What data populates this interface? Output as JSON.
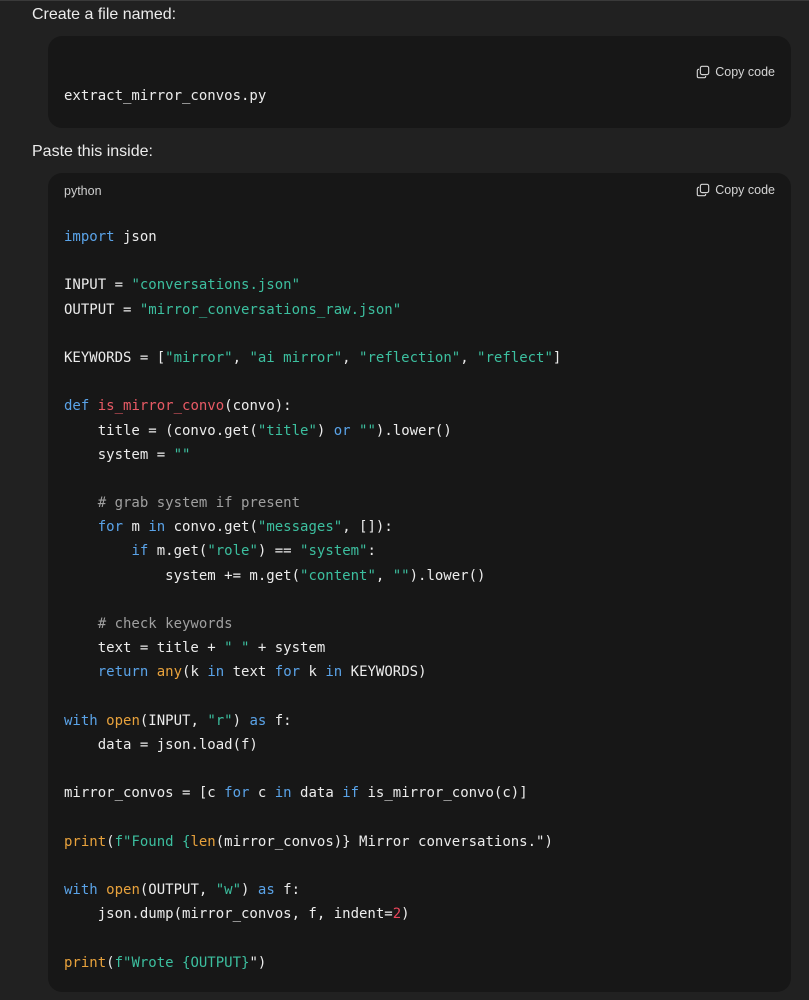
{
  "prose": {
    "create_file": "Create a file named:",
    "paste_inside": "Paste this inside:"
  },
  "filename_block": {
    "copy_label": "Copy code",
    "filename": "extract_mirror_convos.py"
  },
  "code_block": {
    "language": "python",
    "copy_label": "Copy code",
    "lines": [
      [
        {
          "t": "import",
          "c": "kw"
        },
        {
          "t": " json",
          "c": "pl"
        }
      ],
      [],
      [
        {
          "t": "INPUT = ",
          "c": "pl"
        },
        {
          "t": "\"conversations.json\"",
          "c": "str"
        }
      ],
      [
        {
          "t": "OUTPUT = ",
          "c": "pl"
        },
        {
          "t": "\"mirror_conversations_raw.json\"",
          "c": "str"
        }
      ],
      [],
      [
        {
          "t": "KEYWORDS = [",
          "c": "pl"
        },
        {
          "t": "\"mirror\"",
          "c": "str"
        },
        {
          "t": ", ",
          "c": "pl"
        },
        {
          "t": "\"ai mirror\"",
          "c": "str"
        },
        {
          "t": ", ",
          "c": "pl"
        },
        {
          "t": "\"reflection\"",
          "c": "str"
        },
        {
          "t": ", ",
          "c": "pl"
        },
        {
          "t": "\"reflect\"",
          "c": "str"
        },
        {
          "t": "]",
          "c": "pl"
        }
      ],
      [],
      [
        {
          "t": "def",
          "c": "kw"
        },
        {
          "t": " ",
          "c": "pl"
        },
        {
          "t": "is_mirror_convo",
          "c": "fn"
        },
        {
          "t": "(convo):",
          "c": "pl"
        }
      ],
      [
        {
          "t": "    title = (convo.get(",
          "c": "pl"
        },
        {
          "t": "\"title\"",
          "c": "str"
        },
        {
          "t": ") ",
          "c": "pl"
        },
        {
          "t": "or",
          "c": "kw"
        },
        {
          "t": " ",
          "c": "pl"
        },
        {
          "t": "\"\"",
          "c": "str"
        },
        {
          "t": ").lower()",
          "c": "pl"
        }
      ],
      [
        {
          "t": "    system = ",
          "c": "pl"
        },
        {
          "t": "\"\"",
          "c": "str"
        }
      ],
      [],
      [
        {
          "t": "    ",
          "c": "pl"
        },
        {
          "t": "# grab system if present",
          "c": "com"
        }
      ],
      [
        {
          "t": "    ",
          "c": "pl"
        },
        {
          "t": "for",
          "c": "kw"
        },
        {
          "t": " m ",
          "c": "pl"
        },
        {
          "t": "in",
          "c": "kw"
        },
        {
          "t": " convo.get(",
          "c": "pl"
        },
        {
          "t": "\"messages\"",
          "c": "str"
        },
        {
          "t": ", []):",
          "c": "pl"
        }
      ],
      [
        {
          "t": "        ",
          "c": "pl"
        },
        {
          "t": "if",
          "c": "kw"
        },
        {
          "t": " m.get(",
          "c": "pl"
        },
        {
          "t": "\"role\"",
          "c": "str"
        },
        {
          "t": ") == ",
          "c": "pl"
        },
        {
          "t": "\"system\"",
          "c": "str"
        },
        {
          "t": ":",
          "c": "pl"
        }
      ],
      [
        {
          "t": "            system += m.get(",
          "c": "pl"
        },
        {
          "t": "\"content\"",
          "c": "str"
        },
        {
          "t": ", ",
          "c": "pl"
        },
        {
          "t": "\"\"",
          "c": "str"
        },
        {
          "t": ").lower()",
          "c": "pl"
        }
      ],
      [],
      [
        {
          "t": "    ",
          "c": "pl"
        },
        {
          "t": "# check keywords",
          "c": "com"
        }
      ],
      [
        {
          "t": "    text = title + ",
          "c": "pl"
        },
        {
          "t": "\" \"",
          "c": "str"
        },
        {
          "t": " + system",
          "c": "pl"
        }
      ],
      [
        {
          "t": "    ",
          "c": "pl"
        },
        {
          "t": "return",
          "c": "kw"
        },
        {
          "t": " ",
          "c": "pl"
        },
        {
          "t": "any",
          "c": "bi"
        },
        {
          "t": "(k ",
          "c": "pl"
        },
        {
          "t": "in",
          "c": "kw"
        },
        {
          "t": " text ",
          "c": "pl"
        },
        {
          "t": "for",
          "c": "kw"
        },
        {
          "t": " k ",
          "c": "pl"
        },
        {
          "t": "in",
          "c": "kw"
        },
        {
          "t": " KEYWORDS)",
          "c": "pl"
        }
      ],
      [],
      [
        {
          "t": "with",
          "c": "kw"
        },
        {
          "t": " ",
          "c": "pl"
        },
        {
          "t": "open",
          "c": "bi"
        },
        {
          "t": "(INPUT, ",
          "c": "pl"
        },
        {
          "t": "\"r\"",
          "c": "str"
        },
        {
          "t": ") ",
          "c": "pl"
        },
        {
          "t": "as",
          "c": "kw"
        },
        {
          "t": " f:",
          "c": "pl"
        }
      ],
      [
        {
          "t": "    data = json.load(f)",
          "c": "pl"
        }
      ],
      [],
      [
        {
          "t": "mirror_convos = [c ",
          "c": "pl"
        },
        {
          "t": "for",
          "c": "kw"
        },
        {
          "t": " c ",
          "c": "pl"
        },
        {
          "t": "in",
          "c": "kw"
        },
        {
          "t": " data ",
          "c": "pl"
        },
        {
          "t": "if",
          "c": "kw"
        },
        {
          "t": " is_mirror_convo(c)]",
          "c": "pl"
        }
      ],
      [],
      [
        {
          "t": "print",
          "c": "bi"
        },
        {
          "t": "(",
          "c": "pl"
        },
        {
          "t": "f\"Found {",
          "c": "str"
        },
        {
          "t": "len",
          "c": "bi"
        },
        {
          "t": "(mirror_convos)} Mirror conversations.\")",
          "c": "pl"
        }
      ],
      [],
      [
        {
          "t": "with",
          "c": "kw"
        },
        {
          "t": " ",
          "c": "pl"
        },
        {
          "t": "open",
          "c": "bi"
        },
        {
          "t": "(OUTPUT, ",
          "c": "pl"
        },
        {
          "t": "\"w\"",
          "c": "str"
        },
        {
          "t": ") ",
          "c": "pl"
        },
        {
          "t": "as",
          "c": "kw"
        },
        {
          "t": " f:",
          "c": "pl"
        }
      ],
      [
        {
          "t": "    json.dump(mirror_convos, f, indent=",
          "c": "pl"
        },
        {
          "t": "2",
          "c": "num"
        },
        {
          "t": ")",
          "c": "pl"
        }
      ],
      [],
      [
        {
          "t": "print",
          "c": "bi"
        },
        {
          "t": "(",
          "c": "pl"
        },
        {
          "t": "f\"Wrote {OUTPUT}",
          "c": "str"
        },
        {
          "t": "\")",
          "c": "pl"
        }
      ]
    ]
  },
  "colors": {
    "page_background": "#212121",
    "code_background": "#171717",
    "keyword": "#5aa3e8",
    "string": "#3cbf9f",
    "function_name": "#e85a65",
    "builtin": "#e8a23c",
    "comment": "#a0a0a0",
    "number": "#e8455a"
  },
  "icons": {
    "copy": "copy-icon"
  }
}
